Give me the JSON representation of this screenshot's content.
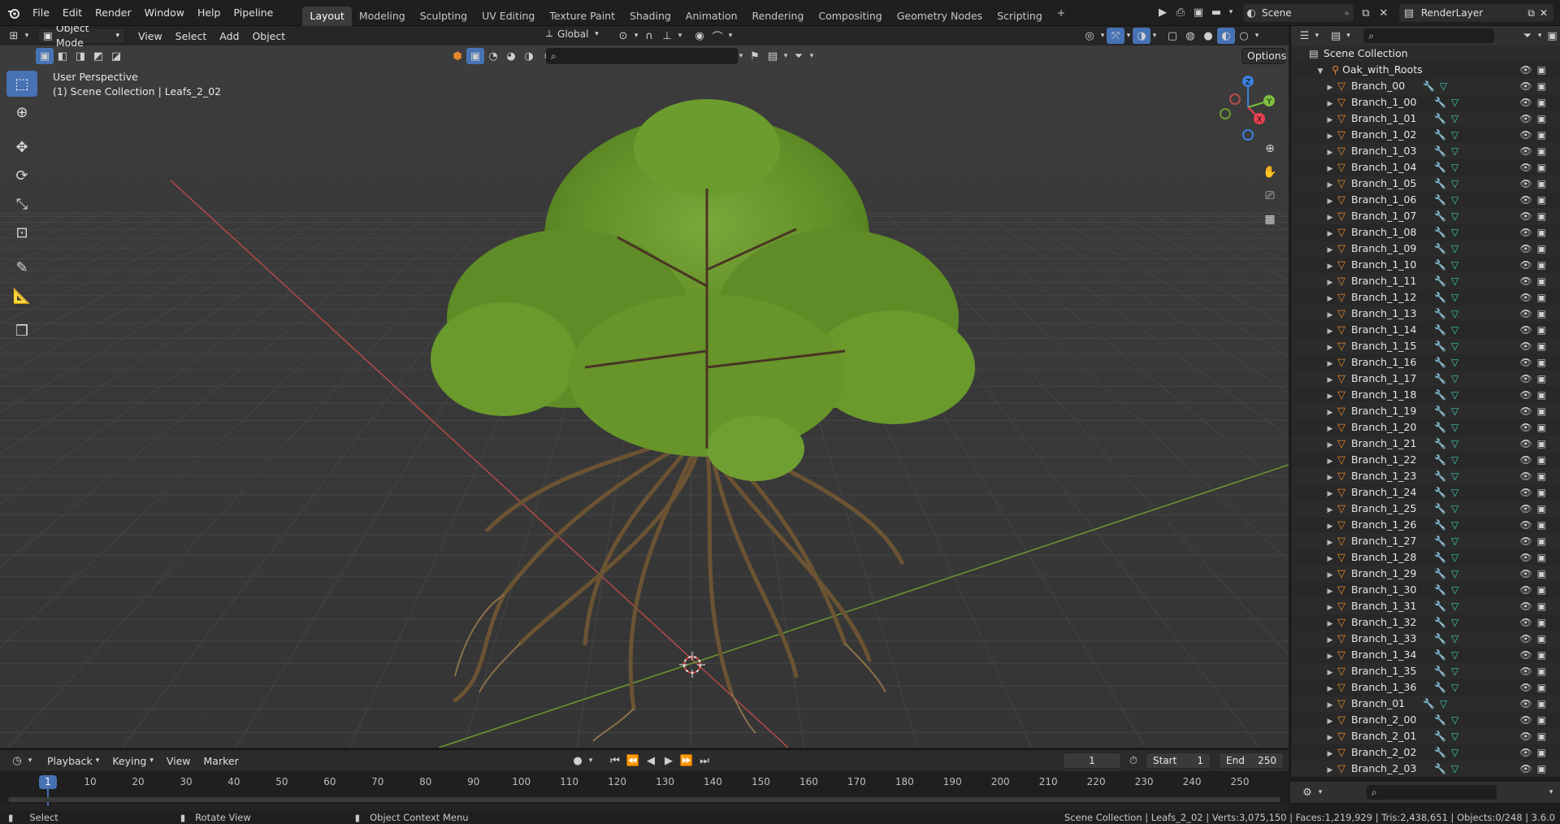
{
  "topbar": {
    "menus": [
      "File",
      "Edit",
      "Render",
      "Window",
      "Help",
      "Pipeline"
    ],
    "workspaces": [
      "Layout",
      "Modeling",
      "Sculpting",
      "UV Editing",
      "Texture Paint",
      "Shading",
      "Animation",
      "Rendering",
      "Compositing",
      "Geometry Nodes",
      "Scripting"
    ],
    "active_workspace": "Layout",
    "add_tab": "+",
    "scene_name": "Scene",
    "view_layer": "RenderLayer"
  },
  "viewport": {
    "mode": "Object Mode",
    "menus": [
      "View",
      "Select",
      "Add",
      "Object"
    ],
    "transform_orientation": "Global",
    "options_label": "Options",
    "perspective_label": "User Perspective",
    "context_label": "(1) Scene Collection | Leafs_2_02",
    "gizmo_axes": {
      "x": "X",
      "y": "Y",
      "z": "Z"
    }
  },
  "outliner": {
    "root": "Scene Collection",
    "collection": "Oak_with_Roots",
    "items": [
      "Branch_00",
      "Branch_1_00",
      "Branch_1_01",
      "Branch_1_02",
      "Branch_1_03",
      "Branch_1_04",
      "Branch_1_05",
      "Branch_1_06",
      "Branch_1_07",
      "Branch_1_08",
      "Branch_1_09",
      "Branch_1_10",
      "Branch_1_11",
      "Branch_1_12",
      "Branch_1_13",
      "Branch_1_14",
      "Branch_1_15",
      "Branch_1_16",
      "Branch_1_17",
      "Branch_1_18",
      "Branch_1_19",
      "Branch_1_20",
      "Branch_1_21",
      "Branch_1_22",
      "Branch_1_23",
      "Branch_1_24",
      "Branch_1_25",
      "Branch_1_26",
      "Branch_1_27",
      "Branch_1_28",
      "Branch_1_29",
      "Branch_1_30",
      "Branch_1_31",
      "Branch_1_32",
      "Branch_1_33",
      "Branch_1_34",
      "Branch_1_35",
      "Branch_1_36",
      "Branch_01",
      "Branch_2_00",
      "Branch_2_01",
      "Branch_2_02",
      "Branch_2_03"
    ]
  },
  "timeline": {
    "menus": [
      "Playback",
      "Keying",
      "View",
      "Marker"
    ],
    "current_frame": "1",
    "start_label": "Start",
    "start": "1",
    "end_label": "End",
    "end": "250",
    "ticks": [
      "1",
      "10",
      "20",
      "30",
      "40",
      "50",
      "60",
      "70",
      "80",
      "90",
      "100",
      "110",
      "120",
      "130",
      "140",
      "150",
      "160",
      "170",
      "180",
      "190",
      "200",
      "210",
      "220",
      "230",
      "240",
      "250"
    ]
  },
  "statusbar": {
    "select": "Select",
    "rotate": "Rotate View",
    "context_menu": "Object Context Menu",
    "stats": "Scene Collection | Leafs_2_02 | Verts:3,075,150 | Faces:1,219,929 | Tris:2,438,651 | Objects:0/248 | 3.6.0"
  },
  "colors": {
    "accent": "#4772b3",
    "object_icon": "#e4882e",
    "x_axis": "#e8414f",
    "y_axis": "#7fbf3f",
    "z_axis": "#3d7fe0"
  }
}
